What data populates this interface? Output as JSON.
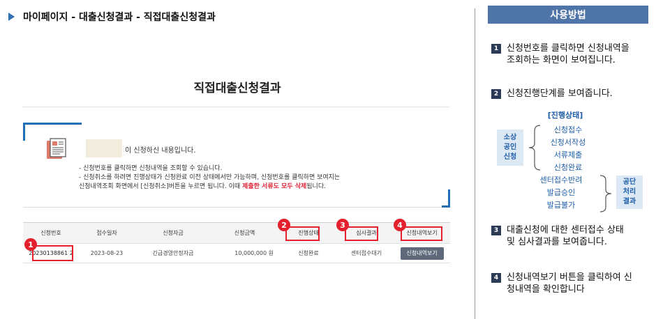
{
  "breadcrumb": "마이페이지 - 대출신청결과 - 직접대출신청결과",
  "main": {
    "title": "직접대출신청결과",
    "intro": "이 신청하신 내용입니다.",
    "notes": [
      "- 신청번호를 클릭하면 신청내역을 조회할 수 있습니다.",
      "- 신청취소를 하려면 진행상태가 신청완료 이전 상태에서만 가능하며, 신청번호를 클릭하면 보여지는",
      "신청내역조회 화면에서 [신청취소]버튼을 누르면 됩니다. 이때 "
    ],
    "notes_red": "제출한 서류도 모두 삭제",
    "notes_tail": "됩니다.",
    "table": {
      "headers": [
        "신청번호",
        "접수일자",
        "신청자금",
        "신청금액",
        "진행상태",
        "심사결과",
        "신청내역보기"
      ],
      "row": [
        "20230138861 2",
        "2023-08-23",
        "긴급경영안정자금",
        "10,000,000 원",
        "신청완료",
        "센터접수대기",
        "신청내역보기"
      ]
    }
  },
  "help": {
    "title": "사용방법",
    "steps": [
      {
        "num": "1",
        "lines": [
          "신청번호를 클릭하면 신청내역을",
          "조회하는 화면이 보여집니다."
        ]
      },
      {
        "num": "2",
        "lines": [
          "신청진행단계를 보여줍니다."
        ]
      },
      {
        "num": "3",
        "lines": [
          "대출신청에 대한 센터접수 상태",
          "및 심사결과를 보여줍니다."
        ]
      },
      {
        "num": "4",
        "lines": [
          "신청내역보기 버튼을 클릭하여 신",
          "청내역을 확인합니다"
        ]
      }
    ],
    "flow": {
      "header": "[진행상태]",
      "left_label": "소상\n공인\n신청",
      "left_items": [
        "신청접수",
        "신청서작성",
        "서류제출",
        "신청완료"
      ],
      "right_items": [
        "센터접수반려",
        "발급승인",
        "발급불가"
      ],
      "right_label": "공단\n처리\n결과"
    }
  },
  "markers": [
    "1",
    "2",
    "3",
    "4"
  ],
  "colors": {
    "accent": "#1f6fb5",
    "marker": "#e3202c",
    "help_header": "#4f74a7"
  }
}
